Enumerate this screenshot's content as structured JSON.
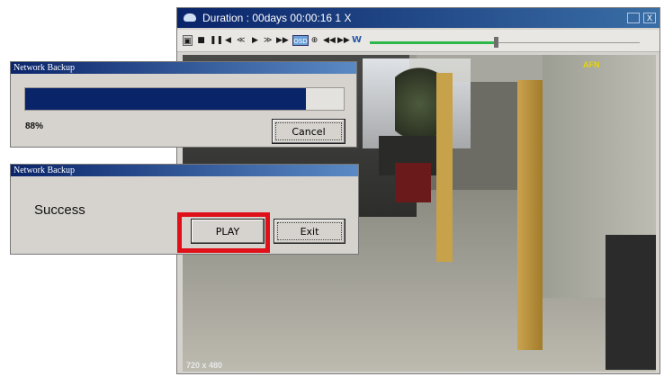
{
  "player": {
    "title": "Duration : 00days 00:00:16  1 X",
    "close_glyph": "X",
    "toolbar": {
      "buttons": [
        {
          "name": "snapshot-button",
          "glyph": "▣"
        },
        {
          "name": "stop-button",
          "glyph": "■"
        },
        {
          "name": "pause-button",
          "glyph": "❚❚"
        },
        {
          "name": "prev-frame-button",
          "glyph": "◀"
        },
        {
          "name": "rewind-button",
          "glyph": "≪"
        },
        {
          "name": "play-button",
          "glyph": "▶"
        },
        {
          "name": "fast-forward-button",
          "glyph": "≫"
        },
        {
          "name": "next-frame-button",
          "glyph": "▶▶"
        },
        {
          "name": "osd-button",
          "glyph": "OSD"
        },
        {
          "name": "zoom-button",
          "glyph": "⊕"
        },
        {
          "name": "step-back-button",
          "glyph": "◀◀"
        },
        {
          "name": "step-forward-button",
          "glyph": "▶▶"
        },
        {
          "name": "w-button",
          "glyph": "W"
        }
      ],
      "speed_level": 0.47
    },
    "video": {
      "camera_mark": "AFN",
      "resolution": "720 x 480"
    }
  },
  "progress_dialog": {
    "title": "Network Backup",
    "progress_percent": 88,
    "percent_label": "88%",
    "cancel_label": "Cancel"
  },
  "success_dialog": {
    "title": "Network Backup",
    "message": "Success",
    "play_label": "PLAY",
    "exit_label": "Exit"
  },
  "colors": {
    "title_bar": "#0a246a",
    "progress_fill": "#0a246a",
    "highlight": "#e0101a",
    "speed_track": "#2fb84a"
  }
}
